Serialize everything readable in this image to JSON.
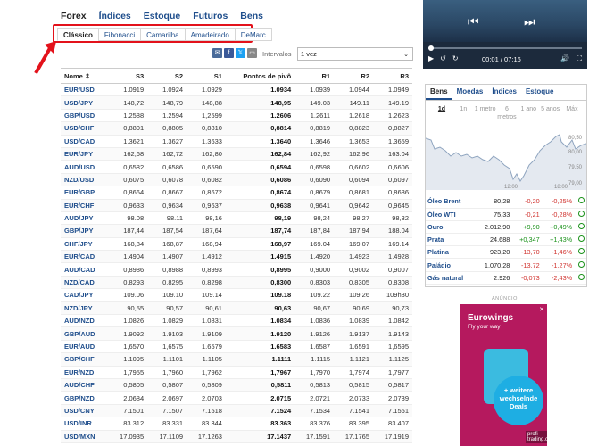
{
  "categories": [
    {
      "label": "Forex",
      "active": true
    },
    {
      "label": "Índices",
      "active": false
    },
    {
      "label": "Estoque",
      "active": false
    },
    {
      "label": "Futuros",
      "active": false
    },
    {
      "label": "Bens",
      "active": false
    }
  ],
  "pivot_tabs": [
    "Clássico",
    "Fibonacci",
    "Camarilha",
    "Amadeirado",
    "DeMarc"
  ],
  "share_icons": [
    "email-icon",
    "facebook-icon",
    "twitter-icon",
    "message-icon"
  ],
  "interval": {
    "label": "Intervalos",
    "value": "1 vez"
  },
  "table": {
    "headers": [
      "Nome",
      "S3",
      "S2",
      "S1",
      "Pontos de pivô",
      "R1",
      "R2",
      "R3"
    ],
    "rows": [
      [
        "EUR/USD",
        "1.0919",
        "1.0924",
        "1.0929",
        "1.0934",
        "1.0939",
        "1.0944",
        "1.0949"
      ],
      [
        "USD/JPY",
        "148,72",
        "148,79",
        "148,88",
        "148,95",
        "149.03",
        "149.11",
        "149.19"
      ],
      [
        "GBP/USD",
        "1.2588",
        "1.2594",
        "1,2599",
        "1.2606",
        "1.2611",
        "1.2618",
        "1.2623"
      ],
      [
        "USD/CHF",
        "0,8801",
        "0,8805",
        "0,8810",
        "0,8814",
        "0,8819",
        "0,8823",
        "0,8827"
      ],
      [
        "USD/CAD",
        "1.3621",
        "1.3627",
        "1.3633",
        "1.3640",
        "1.3646",
        "1.3653",
        "1.3659"
      ],
      [
        "EUR/JPY",
        "162,68",
        "162,72",
        "162,80",
        "162,84",
        "162,92",
        "162,96",
        "163.04"
      ],
      [
        "AUD/USD",
        "0,6582",
        "0,6586",
        "0,6590",
        "0,6594",
        "0,6598",
        "0,6602",
        "0,6606"
      ],
      [
        "NZD/USD",
        "0,6075",
        "0,6078",
        "0,6082",
        "0,6086",
        "0,6090",
        "0,6094",
        "0,6097"
      ],
      [
        "EUR/GBP",
        "0,8664",
        "0,8667",
        "0,8672",
        "0,8674",
        "0,8679",
        "0,8681",
        "0,8686"
      ],
      [
        "EUR/CHF",
        "0,9633",
        "0,9634",
        "0,9637",
        "0,9638",
        "0,9641",
        "0,9642",
        "0,9645"
      ],
      [
        "AUD/JPY",
        "98.08",
        "98.11",
        "98,16",
        "98,19",
        "98,24",
        "98,27",
        "98,32"
      ],
      [
        "GBP/JPY",
        "187,44",
        "187,54",
        "187,64",
        "187,74",
        "187,84",
        "187,94",
        "188.04"
      ],
      [
        "CHF/JPY",
        "168,84",
        "168,87",
        "168,94",
        "168,97",
        "169.04",
        "169.07",
        "169.14"
      ],
      [
        "EUR/CAD",
        "1.4904",
        "1.4907",
        "1.4912",
        "1.4915",
        "1.4920",
        "1.4923",
        "1.4928"
      ],
      [
        "AUD/CAD",
        "0,8986",
        "0,8988",
        "0,8993",
        "0,8995",
        "0,9000",
        "0,9002",
        "0,9007"
      ],
      [
        "NZD/CAD",
        "0,8293",
        "0,8295",
        "0,8298",
        "0,8300",
        "0,8303",
        "0,8305",
        "0,8308"
      ],
      [
        "CAD/JPY",
        "109.06",
        "109.10",
        "109.14",
        "109.18",
        "109.22",
        "109,26",
        "109h30"
      ],
      [
        "NZD/JPY",
        "90,55",
        "90,57",
        "90,61",
        "90,63",
        "90,67",
        "90,69",
        "90,73"
      ],
      [
        "AUD/NZD",
        "1.0826",
        "1.0829",
        "1.0831",
        "1.0834",
        "1.0836",
        "1.0839",
        "1.0842"
      ],
      [
        "GBP/AUD",
        "1.9092",
        "1.9103",
        "1.9109",
        "1.9120",
        "1.9126",
        "1.9137",
        "1.9143"
      ],
      [
        "EUR/AUD",
        "1,6570",
        "1,6575",
        "1.6579",
        "1.6583",
        "1.6587",
        "1.6591",
        "1,6595"
      ],
      [
        "GBP/CHF",
        "1.1095",
        "1.1101",
        "1.1105",
        "1.1111",
        "1.1115",
        "1.1121",
        "1.1125"
      ],
      [
        "EUR/NZD",
        "1,7955",
        "1,7960",
        "1,7962",
        "1,7967",
        "1,7970",
        "1,7974",
        "1,7977"
      ],
      [
        "AUD/CHF",
        "0,5805",
        "0,5807",
        "0,5809",
        "0,5811",
        "0,5813",
        "0,5815",
        "0,5817"
      ],
      [
        "GBP/NZD",
        "2.0684",
        "2.0697",
        "2.0703",
        "2.0715",
        "2.0721",
        "2.0733",
        "2.0739"
      ],
      [
        "USD/CNY",
        "7.1501",
        "7.1507",
        "7.1518",
        "7.1524",
        "7.1534",
        "7.1541",
        "7.1551"
      ],
      [
        "USD/INR",
        "83.312",
        "83.331",
        "83.344",
        "83.363",
        "83.376",
        "83.395",
        "83.407"
      ],
      [
        "USD/MXN",
        "17.0935",
        "17.1109",
        "17.1263",
        "17.1437",
        "17.1591",
        "17.1765",
        "17.1919"
      ],
      [
        "USD/ZAR",
        "18.6429",
        "18.6657",
        "18.6815",
        "18.7043",
        "18.7201",
        "18.7429",
        "18.7587"
      ]
    ]
  },
  "video": {
    "time": "00:01 / 07:16"
  },
  "bens": {
    "tabs": [
      "Bens",
      "Moedas",
      "Índices",
      "Estoque"
    ],
    "ranges": [
      "1d",
      "1n",
      "1 metro",
      "6 metros",
      "1 ano",
      "5 anos",
      "Máx"
    ],
    "chart_axis": [
      "80,50",
      "80,00",
      "79,50",
      "79,00"
    ],
    "chart_times": [
      "12:00",
      "18:00"
    ],
    "commodities": [
      {
        "name": "Óleo Brent",
        "price": "80,28",
        "change": "-0,20",
        "pct": "-0,25%",
        "dir": "neg"
      },
      {
        "name": "Óleo WTI",
        "price": "75,33",
        "change": "-0,21",
        "pct": "-0,28%",
        "dir": "neg"
      },
      {
        "name": "Ouro",
        "price": "2.012,90",
        "change": "+9,90",
        "pct": "+0,49%",
        "dir": "pos"
      },
      {
        "name": "Prata",
        "price": "24.688",
        "change": "+0,347",
        "pct": "+1,43%",
        "dir": "pos"
      },
      {
        "name": "Platina",
        "price": "923,20",
        "change": "-13,70",
        "pct": "-1,46%",
        "dir": "neg"
      },
      {
        "name": "Paládio",
        "price": "1.070,28",
        "change": "-13,72",
        "pct": "-1,27%",
        "dir": "neg"
      },
      {
        "name": "Gás natural",
        "price": "2.926",
        "change": "-0,073",
        "pct": "-2,43%",
        "dir": "neg"
      }
    ]
  },
  "ad": {
    "label": "ANÚNCIO",
    "brand": "Eurowings",
    "tagline": "Fly your way",
    "deals": "+ weitere wechselnde Deals",
    "watermark": "profi-trading.com"
  }
}
